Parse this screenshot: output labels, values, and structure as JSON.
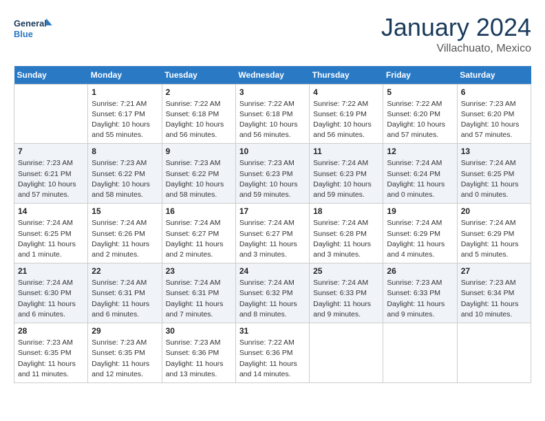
{
  "header": {
    "logo_line1": "General",
    "logo_line2": "Blue",
    "month_title": "January 2024",
    "location": "Villachuato, Mexico"
  },
  "weekdays": [
    "Sunday",
    "Monday",
    "Tuesday",
    "Wednesday",
    "Thursday",
    "Friday",
    "Saturday"
  ],
  "weeks": [
    [
      {
        "day": "",
        "sunrise": "",
        "sunset": "",
        "daylight": ""
      },
      {
        "day": "1",
        "sunrise": "Sunrise: 7:21 AM",
        "sunset": "Sunset: 6:17 PM",
        "daylight": "Daylight: 10 hours and 55 minutes."
      },
      {
        "day": "2",
        "sunrise": "Sunrise: 7:22 AM",
        "sunset": "Sunset: 6:18 PM",
        "daylight": "Daylight: 10 hours and 56 minutes."
      },
      {
        "day": "3",
        "sunrise": "Sunrise: 7:22 AM",
        "sunset": "Sunset: 6:18 PM",
        "daylight": "Daylight: 10 hours and 56 minutes."
      },
      {
        "day": "4",
        "sunrise": "Sunrise: 7:22 AM",
        "sunset": "Sunset: 6:19 PM",
        "daylight": "Daylight: 10 hours and 56 minutes."
      },
      {
        "day": "5",
        "sunrise": "Sunrise: 7:22 AM",
        "sunset": "Sunset: 6:20 PM",
        "daylight": "Daylight: 10 hours and 57 minutes."
      },
      {
        "day": "6",
        "sunrise": "Sunrise: 7:23 AM",
        "sunset": "Sunset: 6:20 PM",
        "daylight": "Daylight: 10 hours and 57 minutes."
      }
    ],
    [
      {
        "day": "7",
        "sunrise": "Sunrise: 7:23 AM",
        "sunset": "Sunset: 6:21 PM",
        "daylight": "Daylight: 10 hours and 57 minutes."
      },
      {
        "day": "8",
        "sunrise": "Sunrise: 7:23 AM",
        "sunset": "Sunset: 6:22 PM",
        "daylight": "Daylight: 10 hours and 58 minutes."
      },
      {
        "day": "9",
        "sunrise": "Sunrise: 7:23 AM",
        "sunset": "Sunset: 6:22 PM",
        "daylight": "Daylight: 10 hours and 58 minutes."
      },
      {
        "day": "10",
        "sunrise": "Sunrise: 7:23 AM",
        "sunset": "Sunset: 6:23 PM",
        "daylight": "Daylight: 10 hours and 59 minutes."
      },
      {
        "day": "11",
        "sunrise": "Sunrise: 7:24 AM",
        "sunset": "Sunset: 6:23 PM",
        "daylight": "Daylight: 10 hours and 59 minutes."
      },
      {
        "day": "12",
        "sunrise": "Sunrise: 7:24 AM",
        "sunset": "Sunset: 6:24 PM",
        "daylight": "Daylight: 11 hours and 0 minutes."
      },
      {
        "day": "13",
        "sunrise": "Sunrise: 7:24 AM",
        "sunset": "Sunset: 6:25 PM",
        "daylight": "Daylight: 11 hours and 0 minutes."
      }
    ],
    [
      {
        "day": "14",
        "sunrise": "Sunrise: 7:24 AM",
        "sunset": "Sunset: 6:25 PM",
        "daylight": "Daylight: 11 hours and 1 minute."
      },
      {
        "day": "15",
        "sunrise": "Sunrise: 7:24 AM",
        "sunset": "Sunset: 6:26 PM",
        "daylight": "Daylight: 11 hours and 2 minutes."
      },
      {
        "day": "16",
        "sunrise": "Sunrise: 7:24 AM",
        "sunset": "Sunset: 6:27 PM",
        "daylight": "Daylight: 11 hours and 2 minutes."
      },
      {
        "day": "17",
        "sunrise": "Sunrise: 7:24 AM",
        "sunset": "Sunset: 6:27 PM",
        "daylight": "Daylight: 11 hours and 3 minutes."
      },
      {
        "day": "18",
        "sunrise": "Sunrise: 7:24 AM",
        "sunset": "Sunset: 6:28 PM",
        "daylight": "Daylight: 11 hours and 3 minutes."
      },
      {
        "day": "19",
        "sunrise": "Sunrise: 7:24 AM",
        "sunset": "Sunset: 6:29 PM",
        "daylight": "Daylight: 11 hours and 4 minutes."
      },
      {
        "day": "20",
        "sunrise": "Sunrise: 7:24 AM",
        "sunset": "Sunset: 6:29 PM",
        "daylight": "Daylight: 11 hours and 5 minutes."
      }
    ],
    [
      {
        "day": "21",
        "sunrise": "Sunrise: 7:24 AM",
        "sunset": "Sunset: 6:30 PM",
        "daylight": "Daylight: 11 hours and 6 minutes."
      },
      {
        "day": "22",
        "sunrise": "Sunrise: 7:24 AM",
        "sunset": "Sunset: 6:31 PM",
        "daylight": "Daylight: 11 hours and 6 minutes."
      },
      {
        "day": "23",
        "sunrise": "Sunrise: 7:24 AM",
        "sunset": "Sunset: 6:31 PM",
        "daylight": "Daylight: 11 hours and 7 minutes."
      },
      {
        "day": "24",
        "sunrise": "Sunrise: 7:24 AM",
        "sunset": "Sunset: 6:32 PM",
        "daylight": "Daylight: 11 hours and 8 minutes."
      },
      {
        "day": "25",
        "sunrise": "Sunrise: 7:24 AM",
        "sunset": "Sunset: 6:33 PM",
        "daylight": "Daylight: 11 hours and 9 minutes."
      },
      {
        "day": "26",
        "sunrise": "Sunrise: 7:23 AM",
        "sunset": "Sunset: 6:33 PM",
        "daylight": "Daylight: 11 hours and 9 minutes."
      },
      {
        "day": "27",
        "sunrise": "Sunrise: 7:23 AM",
        "sunset": "Sunset: 6:34 PM",
        "daylight": "Daylight: 11 hours and 10 minutes."
      }
    ],
    [
      {
        "day": "28",
        "sunrise": "Sunrise: 7:23 AM",
        "sunset": "Sunset: 6:35 PM",
        "daylight": "Daylight: 11 hours and 11 minutes."
      },
      {
        "day": "29",
        "sunrise": "Sunrise: 7:23 AM",
        "sunset": "Sunset: 6:35 PM",
        "daylight": "Daylight: 11 hours and 12 minutes."
      },
      {
        "day": "30",
        "sunrise": "Sunrise: 7:23 AM",
        "sunset": "Sunset: 6:36 PM",
        "daylight": "Daylight: 11 hours and 13 minutes."
      },
      {
        "day": "31",
        "sunrise": "Sunrise: 7:22 AM",
        "sunset": "Sunset: 6:36 PM",
        "daylight": "Daylight: 11 hours and 14 minutes."
      },
      {
        "day": "",
        "sunrise": "",
        "sunset": "",
        "daylight": ""
      },
      {
        "day": "",
        "sunrise": "",
        "sunset": "",
        "daylight": ""
      },
      {
        "day": "",
        "sunrise": "",
        "sunset": "",
        "daylight": ""
      }
    ]
  ]
}
